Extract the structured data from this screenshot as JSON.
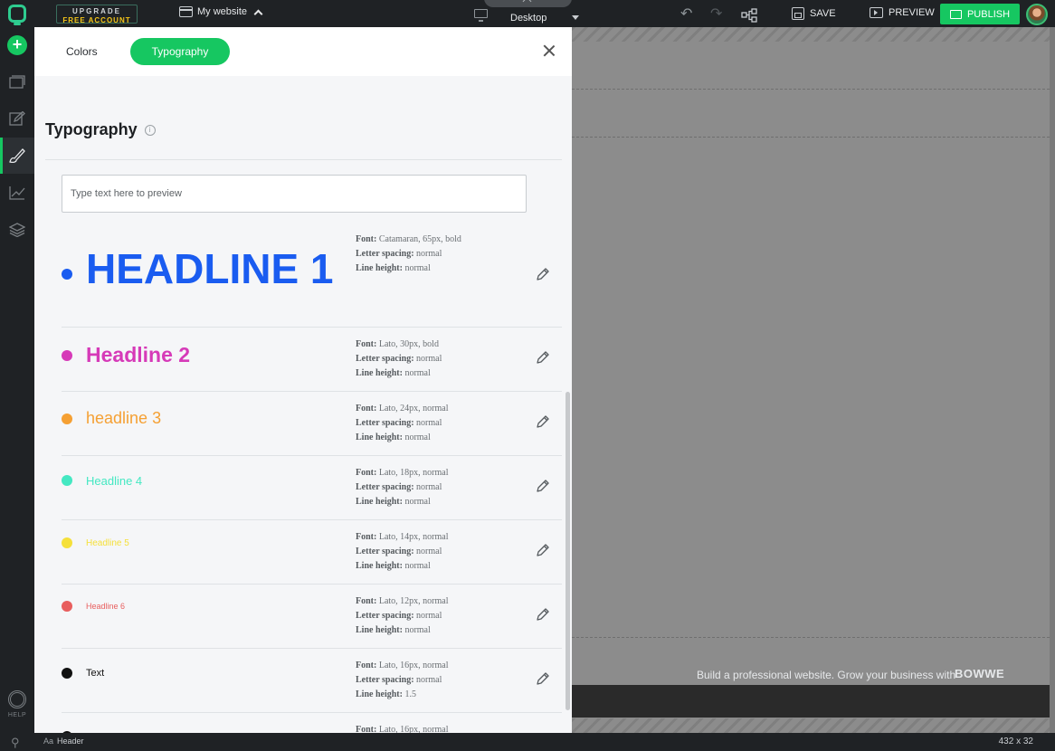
{
  "topbar": {
    "upgrade_line1": "UPGRADE",
    "upgrade_line2": "FREE ACCOUNT",
    "website_label": "My website",
    "device_label": "Desktop",
    "save_label": "SAVE",
    "preview_label": "PREVIEW",
    "publish_label": "PUBLISH"
  },
  "rail": {
    "add_label": "+",
    "help_label": "HELP"
  },
  "panel": {
    "tab_colors": "Colors",
    "tab_typography": "Typography",
    "section_title": "Typography",
    "info_glyph": "i",
    "preview_placeholder": "Type text here to preview",
    "font_label": "Font:",
    "spacing_label": "Letter spacing:",
    "lineheight_label": "Line height:",
    "styles": [
      {
        "sample": "HEADLINE 1",
        "color": "#1a5cf0",
        "font": "Catamaran, 65px, bold",
        "letter_spacing": "normal",
        "line_height": "normal"
      },
      {
        "sample": "Headline 2",
        "color": "#d63ab8",
        "font": "Lato, 30px, bold",
        "letter_spacing": "normal",
        "line_height": "normal"
      },
      {
        "sample": "headline 3",
        "color": "#f5a033",
        "font": "Lato, 24px, normal",
        "letter_spacing": "normal",
        "line_height": "normal"
      },
      {
        "sample": "Headline 4",
        "color": "#44e8c2",
        "font": "Lato, 18px, normal",
        "letter_spacing": "normal",
        "line_height": "normal"
      },
      {
        "sample": "Headline 5",
        "color": "#f5e03a",
        "font": "Lato, 14px, normal",
        "letter_spacing": "normal",
        "line_height": "normal"
      },
      {
        "sample": "Headline 6",
        "color": "#e85e5e",
        "font": "Lato, 12px, normal",
        "letter_spacing": "normal",
        "line_height": "normal"
      },
      {
        "sample": "Text",
        "color": "#111111",
        "font": "Lato, 16px, normal",
        "letter_spacing": "normal",
        "line_height": "1.5"
      },
      {
        "sample": "",
        "color": "#111111",
        "font": "Lato, 16px, normal",
        "letter_spacing": "",
        "line_height": ""
      }
    ]
  },
  "canvas": {
    "footer_text": "Build a professional website. Grow your business with",
    "footer_brand": "BOWWE"
  },
  "bottombar": {
    "element_prefix": "Aa",
    "element_label": "Header",
    "size_readout": "432 x 32"
  },
  "colors": {
    "accent": "#16c761",
    "dark": "#1f2225"
  }
}
